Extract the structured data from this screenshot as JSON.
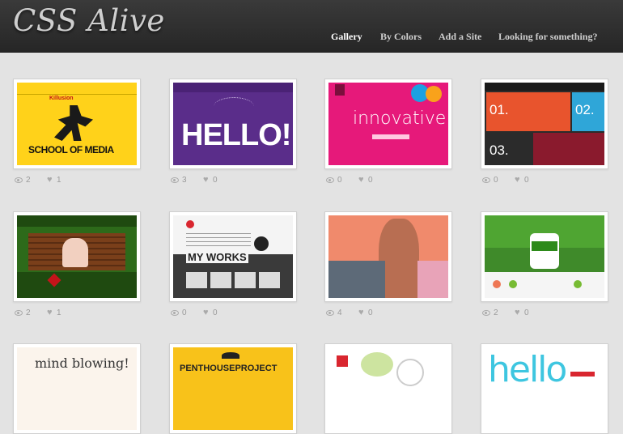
{
  "header": {
    "logo": "CSS Alive",
    "nav": [
      {
        "label": "Gallery",
        "active": true
      },
      {
        "label": "By Colors",
        "active": false
      },
      {
        "label": "Add a Site",
        "active": false
      },
      {
        "label": "Looking for something?",
        "active": false
      }
    ]
  },
  "gallery": [
    {
      "views": "2",
      "likes": "1",
      "t1": "SCHOOL OF MEDIA",
      "t2": "Killusion"
    },
    {
      "views": "3",
      "likes": "0",
      "t1": "HELLO!"
    },
    {
      "views": "0",
      "likes": "0",
      "t1": "innovative"
    },
    {
      "views": "0",
      "likes": "0",
      "t1": "01.",
      "t2": "02.",
      "t3": "03."
    },
    {
      "views": "2",
      "likes": "1"
    },
    {
      "views": "0",
      "likes": "0",
      "t1": "MY WORKS"
    },
    {
      "views": "4",
      "likes": "0"
    },
    {
      "views": "2",
      "likes": "0"
    },
    {
      "t1": "mind blowing!"
    },
    {
      "t1": "PENTHOUSEPROJECT"
    },
    {},
    {
      "t1": "hello"
    }
  ],
  "colors": {
    "header": "#2e2e2e",
    "background": "#e3e3e3",
    "icon": "#aaaaaa"
  }
}
